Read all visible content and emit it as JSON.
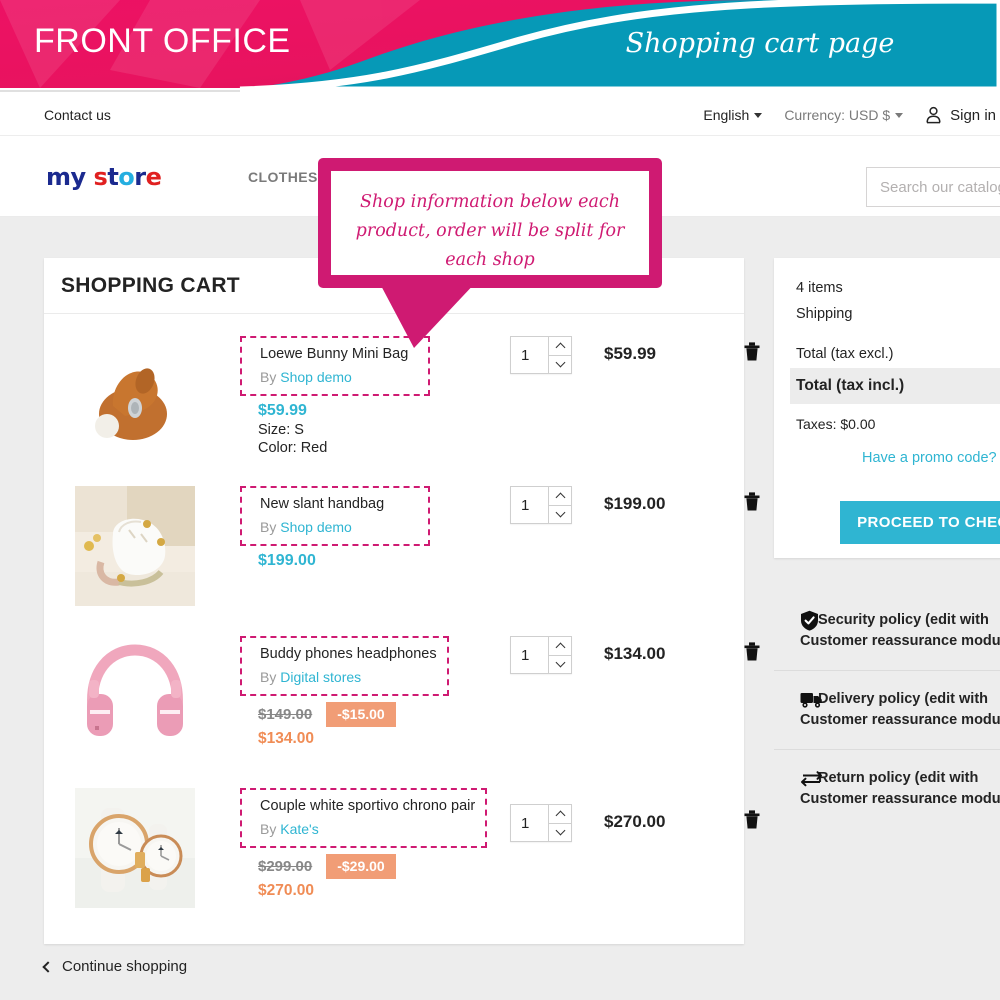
{
  "banner": {
    "title": "FRONT OFFICE",
    "subtitle": "Shopping cart page",
    "pink": "#ED1164",
    "teal": "#0699B7"
  },
  "topnav": {
    "contact": "Contact us",
    "language": "English",
    "currency": "Currency: USD $",
    "signin": "Sign in"
  },
  "header": {
    "logo_my": "my",
    "logo_s": "s",
    "logo_t": "t",
    "logo_o": "o",
    "logo_r": "r",
    "logo_e": "e",
    "nav_clothes": "CLOTHES",
    "search_placeholder": "Search our catalog"
  },
  "callout": {
    "line1": "Shop information below each",
    "line2": "product, order will be split for",
    "line3": "each shop",
    "color": "#CF1A72"
  },
  "cart": {
    "title": "SHOPPING CART",
    "continue_shopping": "Continue shopping",
    "items": [
      {
        "name": "Loewe Bunny Mini Bag",
        "by_label": "By",
        "shop": "Shop demo",
        "unit_price": "$59.99",
        "attributes": [
          "Size: S",
          "Color: Red"
        ],
        "old_price": null,
        "discount": null,
        "new_price": null,
        "qty": "1",
        "total": "$59.99"
      },
      {
        "name": "New slant handbag",
        "by_label": "By",
        "shop": "Shop demo",
        "unit_price": "$199.00",
        "attributes": [],
        "old_price": null,
        "discount": null,
        "new_price": null,
        "qty": "1",
        "total": "$199.00"
      },
      {
        "name": "Buddy phones headphones",
        "by_label": "By",
        "shop": "Digital stores",
        "unit_price": null,
        "attributes": [],
        "old_price": "$149.00",
        "discount": "-$15.00",
        "new_price": "$134.00",
        "qty": "1",
        "total": "$134.00"
      },
      {
        "name": "Couple white sportivo chrono pair",
        "by_label": "By",
        "shop": "Kate's",
        "unit_price": null,
        "attributes": [],
        "old_price": "$299.00",
        "discount": "-$29.00",
        "new_price": "$270.00",
        "qty": "1",
        "total": "$270.00"
      }
    ]
  },
  "summary": {
    "items_count": "4 items",
    "shipping": "Shipping",
    "total_excl": "Total (tax excl.)",
    "total_incl": "Total (tax incl.)",
    "taxes": "Taxes: $0.00",
    "promo": "Have a promo code?",
    "checkout": "PROCEED TO CHECKOUT",
    "accent": "#2FB5D2"
  },
  "reassurance": [
    {
      "icon": "shield-icon",
      "text": "Security policy (edit with Customer reassurance module)"
    },
    {
      "icon": "truck-icon",
      "text": "Delivery policy (edit with Customer reassurance module)"
    },
    {
      "icon": "return-arrows-icon",
      "text": "Return policy (edit with Customer reassurance module)"
    }
  ]
}
